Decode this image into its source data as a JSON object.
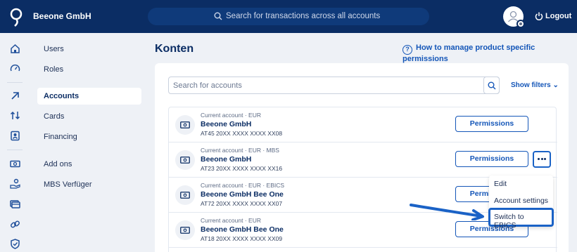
{
  "header": {
    "company": "Beeone GmbH",
    "search_placeholder": "Search for transactions across all accounts",
    "logout_label": "Logout",
    "brand_color": "#0b2d64"
  },
  "rail_icons": [
    "home-icon",
    "speedometer-icon",
    "arrow-up-right-icon",
    "transfer-icon",
    "contacts-icon",
    "cash-icon",
    "coins-hand-icon",
    "cards-icon",
    "link-icon",
    "shield-icon"
  ],
  "nav": {
    "items": [
      {
        "label": "Users"
      },
      {
        "label": "Roles"
      },
      {
        "label": "Accounts"
      },
      {
        "label": "Cards"
      },
      {
        "label": "Financing"
      },
      {
        "label": "Add ons"
      },
      {
        "label": "MBS Verfüger"
      }
    ]
  },
  "main": {
    "title": "Konten",
    "help_link": "How to manage product specific permissions",
    "search_placeholder": "Search for accounts",
    "filters_label": "Show filters"
  },
  "accounts": [
    {
      "meta": "Current account · EUR",
      "name": "Beeone GmbH",
      "iban": "AT45 20XX XXXX XXXX XX08",
      "button": "Permissions"
    },
    {
      "meta": "Current account · EUR · MBS",
      "name": "Beeone GmbH",
      "iban": "AT23 20XX XXXX XXXX XX16",
      "button": "Permissions"
    },
    {
      "meta": "Current account · EUR · EBICS",
      "name": "Beeone GmbH Bee One",
      "iban": "AT72 20XX XXXX XXXX XX07",
      "button": "Permissions"
    },
    {
      "meta": "Current account · EUR",
      "name": "Beeone GmbH Bee One",
      "iban": "AT18 20XX XXXX XXXX XX09",
      "button": "Permissions"
    }
  ],
  "context_menu": {
    "items": [
      "Edit",
      "Account settings",
      "Switch to EBICS"
    ],
    "highlight_color": "#1a62c6"
  }
}
